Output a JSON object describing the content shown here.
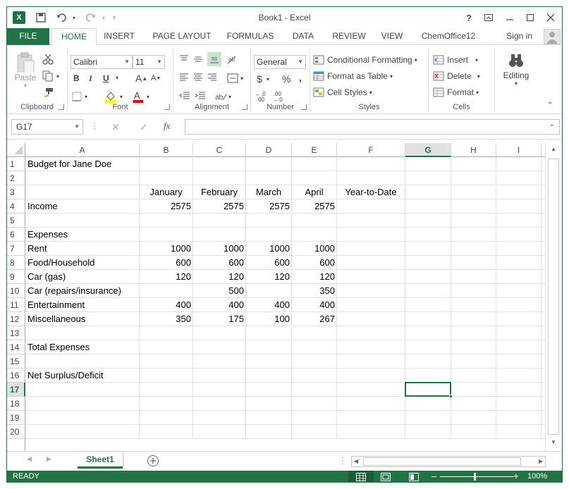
{
  "window": {
    "title": "Book1 - Excel"
  },
  "ribbon_tabs": [
    "FILE",
    "HOME",
    "INSERT",
    "PAGE LAYOUT",
    "FORMULAS",
    "DATA",
    "REVIEW",
    "VIEW",
    "ChemOffice12"
  ],
  "sign_in": "Sign in",
  "clipboard": {
    "paste": "Paste",
    "label": "Clipboard"
  },
  "font": {
    "name": "Calibri",
    "size": "11",
    "label": "Font"
  },
  "alignment": {
    "label": "Alignment"
  },
  "number": {
    "format": "General",
    "label": "Number"
  },
  "styles": {
    "conditional": "Conditional Formatting",
    "table": "Format as Table",
    "cell_styles": "Cell Styles",
    "label": "Styles"
  },
  "cells": {
    "insert": "Insert",
    "delete": "Delete",
    "format": "Format",
    "label": "Cells"
  },
  "editing": {
    "label": "Editing"
  },
  "formula_bar": {
    "name_box": "G17",
    "fx": "fx",
    "value": ""
  },
  "columns": [
    "A",
    "B",
    "C",
    "D",
    "E",
    "F",
    "G",
    "H",
    "I"
  ],
  "rows": [
    "1",
    "2",
    "3",
    "4",
    "5",
    "6",
    "7",
    "8",
    "9",
    "10",
    "11",
    "12",
    "13",
    "14",
    "15",
    "16",
    "17",
    "18",
    "19",
    "20"
  ],
  "selected": {
    "col": "G",
    "row": "17"
  },
  "cells_data": {
    "A1": "Budget for Jane Doe",
    "B3": "January",
    "C3": "February",
    "D3": "March",
    "E3": "April",
    "F3": "Year-to-Date",
    "A4": "Income",
    "B4": "2575",
    "C4": "2575",
    "D4": "2575",
    "E4": "2575",
    "A6": "Expenses",
    "A7": "Rent",
    "B7": "1000",
    "C7": "1000",
    "D7": "1000",
    "E7": "1000",
    "A8": "Food/Household",
    "B8": "600",
    "C8": "600",
    "D8": "600",
    "E8": "600",
    "A9": "Car (gas)",
    "B9": "120",
    "C9": "120",
    "D9": "120",
    "E9": "120",
    "A10": "Car (repairs/insurance)",
    "C10": "500",
    "E10": "350",
    "A11": "Entertainment",
    "B11": "400",
    "C11": "400",
    "D11": "400",
    "E11": "400",
    "A12": "Miscellaneous",
    "B12": "350",
    "C12": "175",
    "D12": "100",
    "E12": "267",
    "A14": "Total Expenses",
    "A16": "Net Surplus/Deficit"
  },
  "sheet_tab": "Sheet1",
  "status": {
    "ready": "READY",
    "zoom": "100%"
  }
}
